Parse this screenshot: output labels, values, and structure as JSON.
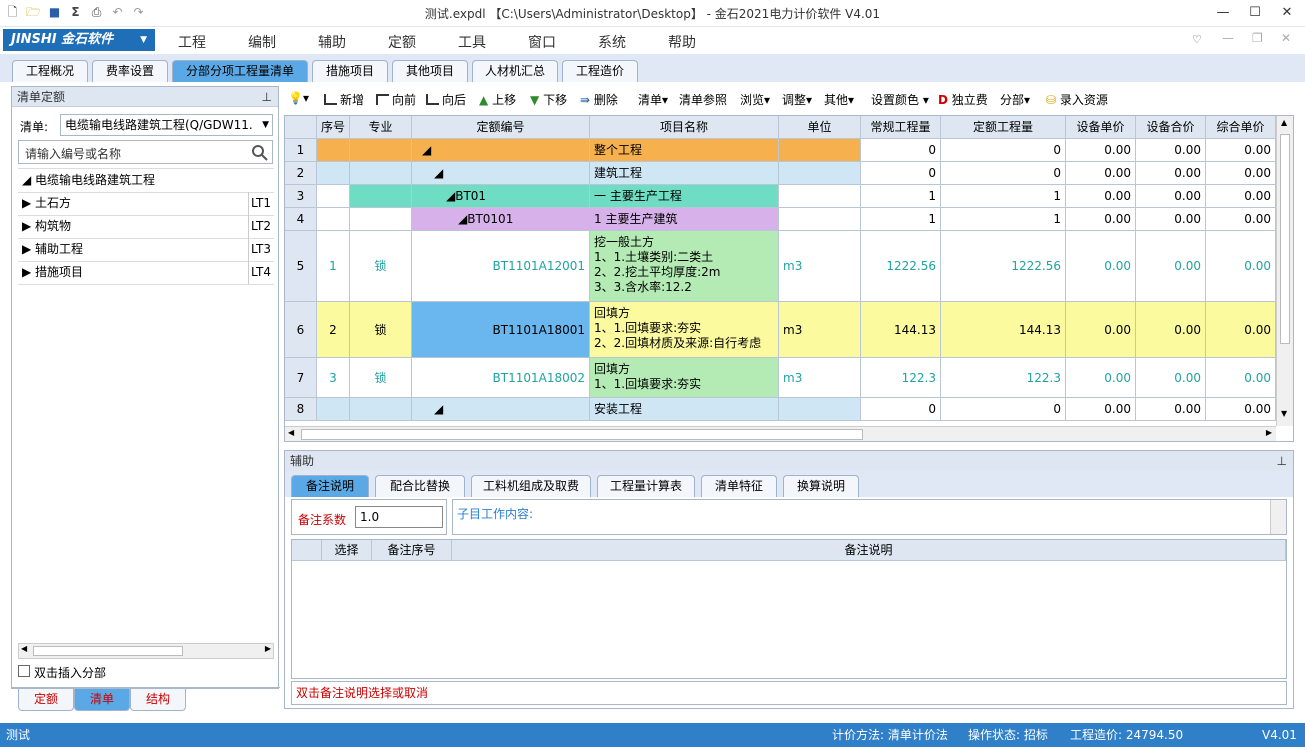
{
  "window": {
    "title": "测试.expdl 【C:\\Users\\Administrator\\Desktop】 - 金石2021电力计价软件 V4.01"
  },
  "brand": {
    "label": "JINSHI 金石软件"
  },
  "menu": [
    "工程",
    "编制",
    "辅助",
    "定额",
    "工具",
    "窗口",
    "系统",
    "帮助"
  ],
  "main_tabs": [
    "工程概况",
    "费率设置",
    "分部分项工程量清单",
    "措施项目",
    "其他项目",
    "人材机汇总",
    "工程造价"
  ],
  "left_panel": {
    "header": "清单定额",
    "list_label": "清单:",
    "list_value": "电缆输电线路建筑工程(Q/GDW11.",
    "search_placeholder": "请输入编号或名称",
    "root": "电缆输电线路建筑工程",
    "items": [
      {
        "name": "土石方",
        "code": "LT1"
      },
      {
        "name": "构筑物",
        "code": "LT2"
      },
      {
        "name": "辅助工程",
        "code": "LT3"
      },
      {
        "name": "措施项目",
        "code": "LT4"
      }
    ],
    "checkbox_label": "双击插入分部",
    "bottom_tabs": [
      "定额",
      "清单",
      "结构"
    ]
  },
  "toolbar": {
    "add": "新增",
    "before": "向前",
    "after": "向后",
    "up": "上移",
    "down": "下移",
    "delete": "删除",
    "list": "清单",
    "list_ref": "清单参照",
    "browse": "浏览",
    "adjust": "调整",
    "other": "其他",
    "set_color": "设置颜色",
    "independent_fee": "独立费",
    "section": "分部",
    "enter_resource": "录入资源"
  },
  "grid": {
    "columns": [
      "序号",
      "专业",
      "定额编号",
      "项目名称",
      "单位",
      "常规工程量",
      "定额工程量",
      "设备单价",
      "设备合价",
      "综合单价"
    ],
    "rows": [
      {
        "row": "1",
        "seq": "",
        "spec": "",
        "code": "◢",
        "name": "整个工程",
        "unit": "",
        "q1": "0",
        "q2": "0",
        "p1": "0.00",
        "p2": "0.00",
        "p3": "0.00"
      },
      {
        "row": "2",
        "seq": "",
        "spec": "",
        "code": "◢",
        "name": "建筑工程",
        "unit": "",
        "q1": "0",
        "q2": "0",
        "p1": "0.00",
        "p2": "0.00",
        "p3": "0.00"
      },
      {
        "row": "3",
        "seq": "",
        "spec": "",
        "code": "◢BT01",
        "name": "一 主要生产工程",
        "unit": "",
        "q1": "1",
        "q2": "1",
        "p1": "0.00",
        "p2": "0.00",
        "p3": "0.00"
      },
      {
        "row": "4",
        "seq": "",
        "spec": "",
        "code": "◢BT0101",
        "name": "1 主要生产建筑",
        "unit": "",
        "q1": "1",
        "q2": "1",
        "p1": "0.00",
        "p2": "0.00",
        "p3": "0.00"
      },
      {
        "row": "5",
        "seq": "1",
        "spec": "锁",
        "code": "BT1101A12001",
        "name": "挖一般土方\n1、1.土壤类别:二类土\n2、2.挖土平均厚度:2m\n3、3.含水率:12.2",
        "unit": "m3",
        "q1": "1222.56",
        "q2": "1222.56",
        "p1": "0.00",
        "p2": "0.00",
        "p3": "0.00"
      },
      {
        "row": "6",
        "seq": "2",
        "spec": "锁",
        "code": "BT1101A18001",
        "name": "回填方\n1、1.回填要求:夯实\n2、2.回填材质及来源:自行考虑",
        "unit": "m3",
        "q1": "144.13",
        "q2": "144.13",
        "p1": "0.00",
        "p2": "0.00",
        "p3": "0.00"
      },
      {
        "row": "7",
        "seq": "3",
        "spec": "锁",
        "code": "BT1101A18002",
        "name": "回填方\n1、1.回填要求:夯实",
        "unit": "m3",
        "q1": "122.3",
        "q2": "122.3",
        "p1": "0.00",
        "p2": "0.00",
        "p3": "0.00"
      },
      {
        "row": "8",
        "seq": "",
        "spec": "",
        "code": "◢",
        "name": "安装工程",
        "unit": "",
        "q1": "0",
        "q2": "0",
        "p1": "0.00",
        "p2": "0.00",
        "p3": "0.00"
      }
    ]
  },
  "aux": {
    "header": "辅助",
    "tabs": [
      "备注说明",
      "配合比替换",
      "工料机组成及取费",
      "工程量计算表",
      "清单特征",
      "换算说明"
    ],
    "coef_label": "备注系数",
    "coef_value": "1.0",
    "content_label": "子目工作内容:",
    "columns": [
      "选择",
      "备注序号",
      "备注说明"
    ],
    "hint": "双击备注说明选择或取消"
  },
  "status": {
    "left": "测试",
    "method": "计价方法: 清单计价法",
    "state": "操作状态: 招标",
    "cost": "工程造价: 24794.50",
    "version": "V4.01"
  }
}
